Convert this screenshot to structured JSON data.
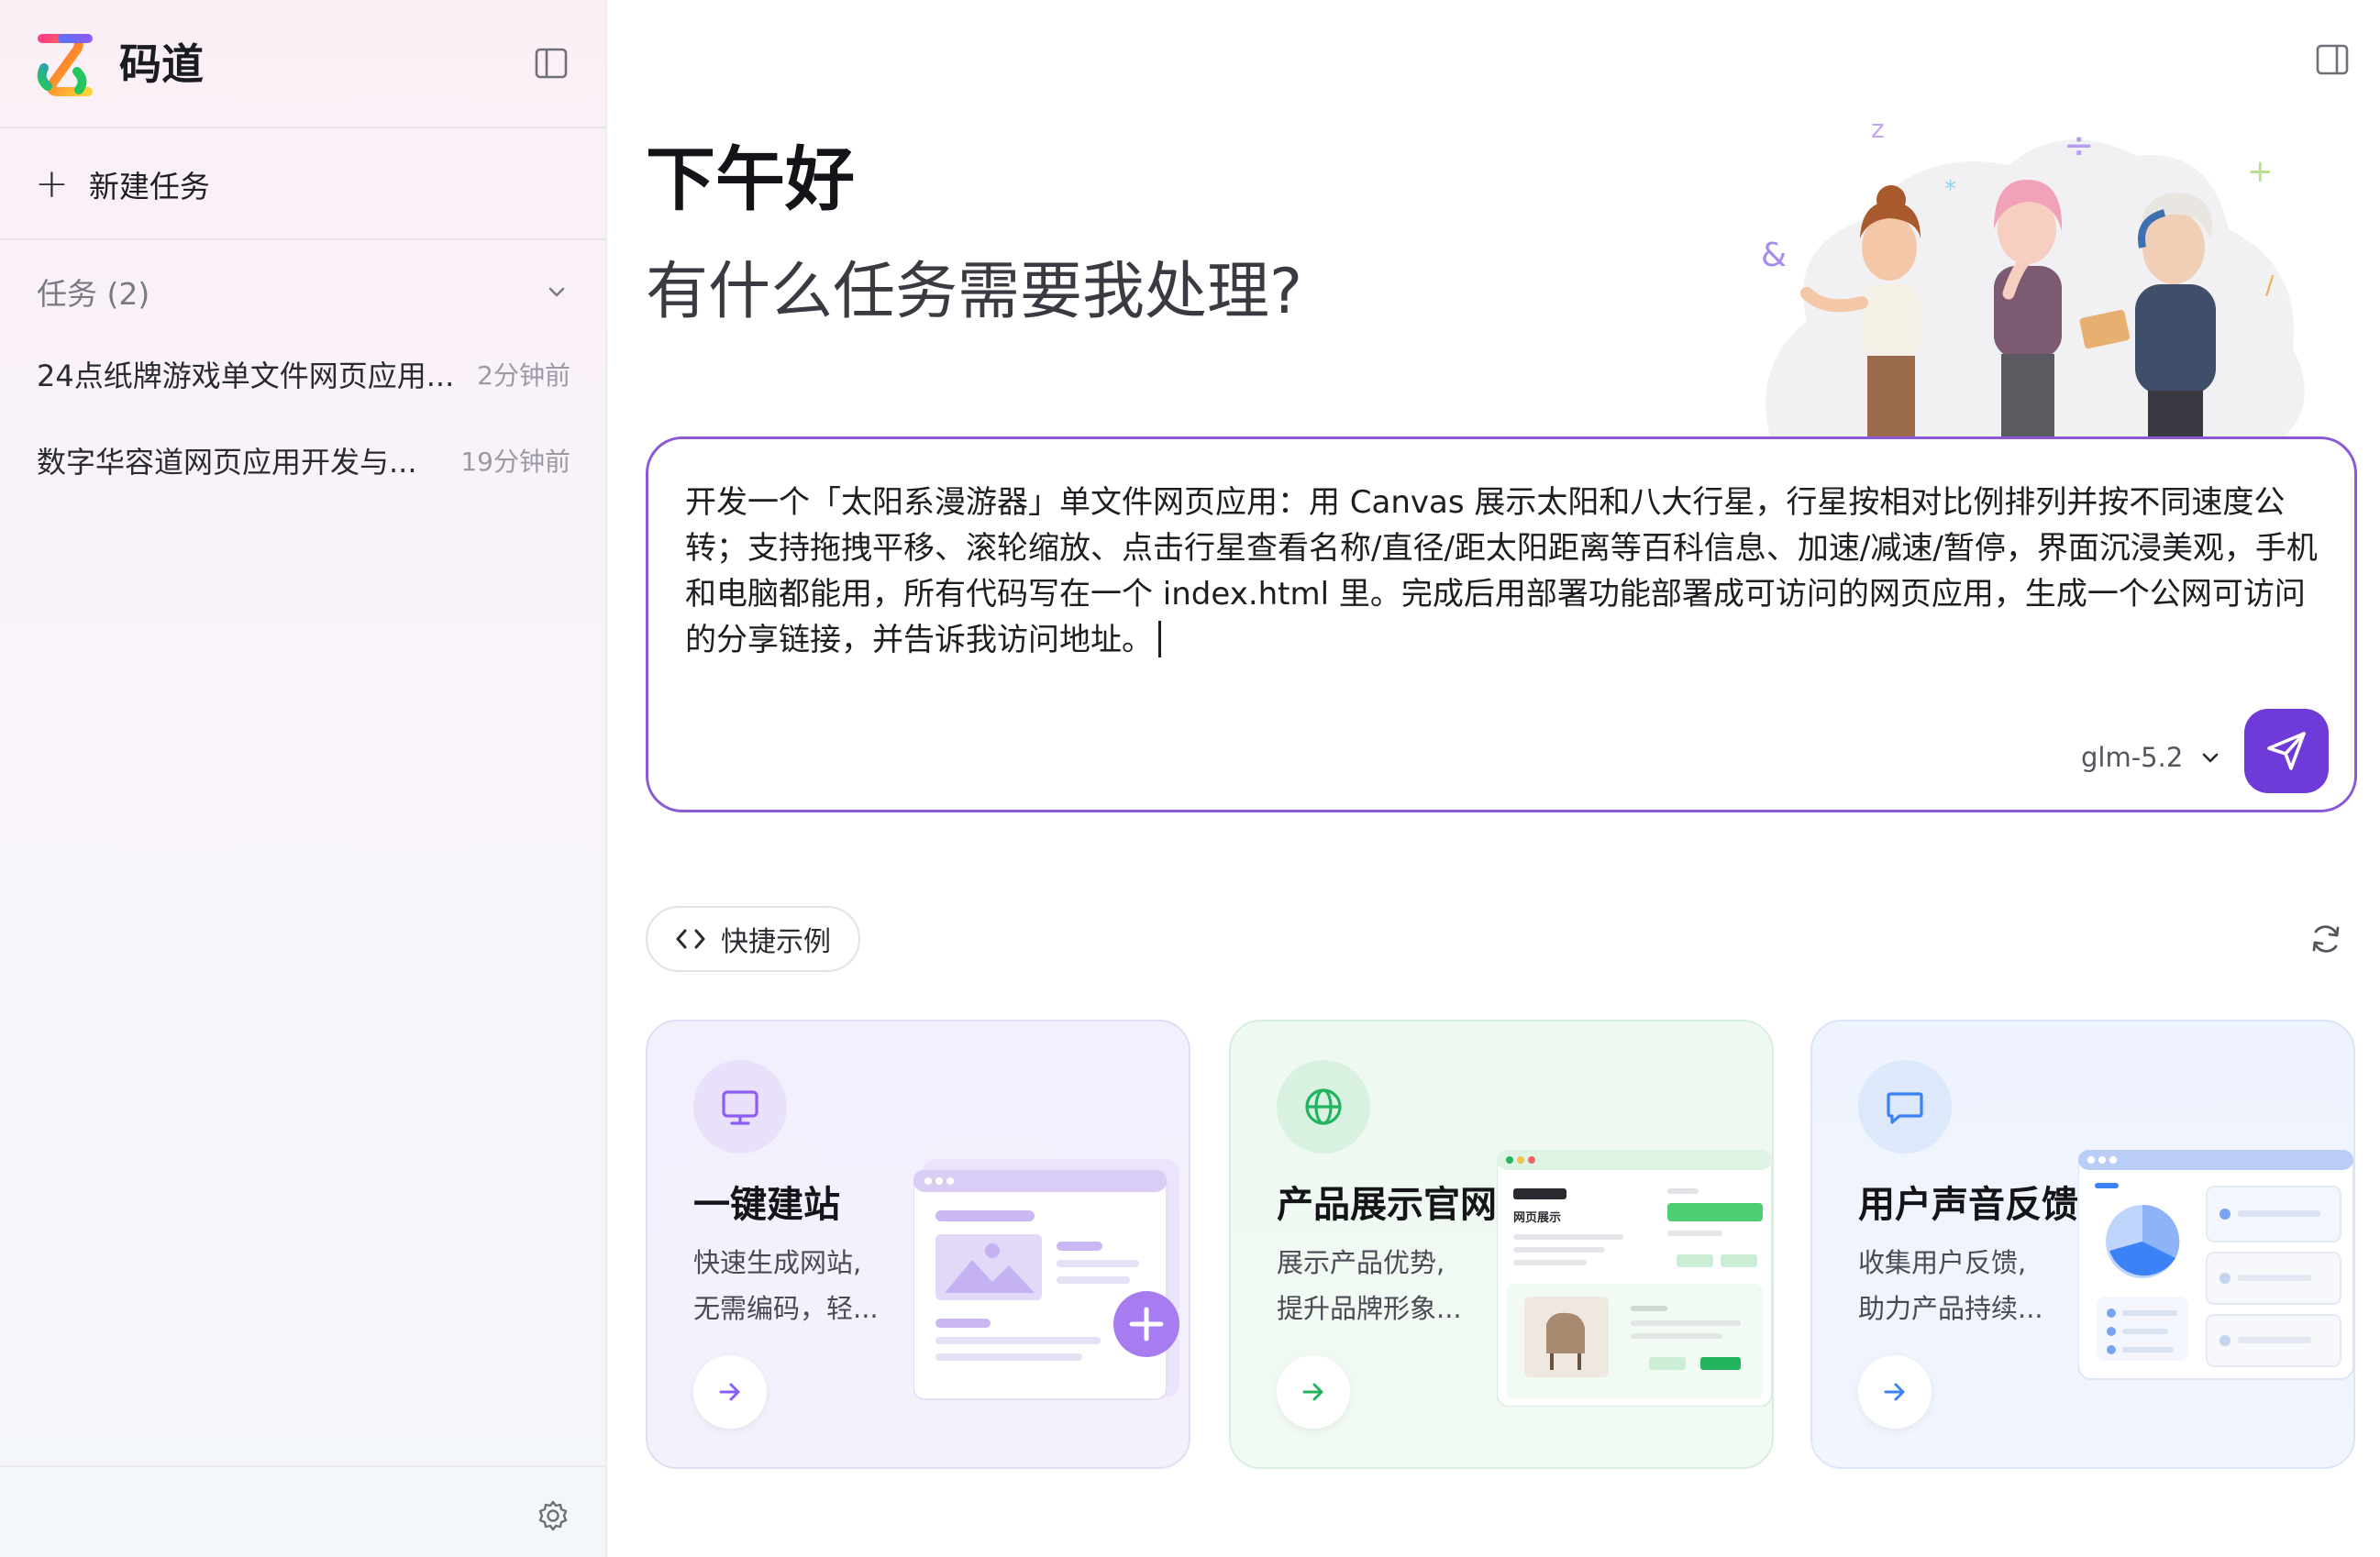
{
  "brand": {
    "name": "码道"
  },
  "sidebar": {
    "new_task_label": "新建任务",
    "tasks_header": "任务 (2)",
    "tasks": [
      {
        "title": "24点纸牌游戏单文件网页应用...",
        "time": "2分钟前"
      },
      {
        "title": "数字华容道网页应用开发与...",
        "time": "19分钟前"
      }
    ]
  },
  "main": {
    "greeting": "下午好",
    "subtitle": "有什么任务需要我处理?",
    "composer": {
      "text": "开发一个「太阳系漫游器」单文件网页应用：用 Canvas 展示太阳和八大行星，行星按相对比例排列并按不同速度公转；支持拖拽平移、滚轮缩放、点击行星查看名称/直径/距太阳距离等百科信息、加速/减速/暂停，界面沉浸美观，手机和电脑都能用，所有代码写在一个 index.html 里。完成后用部署功能部署成可访问的网页应用，生成一个公网可访问的分享链接，并告诉我访问地址。",
      "model": "glm-5.2"
    },
    "quick_examples_label": "快捷示例",
    "cards": [
      {
        "title": "一键建站",
        "desc_line1": "快速生成网站,",
        "desc_line2": "无需编码，轻...",
        "icon": "monitor-icon",
        "accent": "#8b5cf6"
      },
      {
        "title": "产品展示官网",
        "desc_line1": "展示产品优势,",
        "desc_line2": "提升品牌形象...",
        "icon": "globe-icon",
        "accent": "#22b35e",
        "preview_label": "网页展示"
      },
      {
        "title": "用户声音反馈",
        "desc_line1": "收集用户反馈,",
        "desc_line2": "助力产品持续...",
        "icon": "message-square-icon",
        "accent": "#3b82f6"
      }
    ]
  },
  "colors": {
    "accent_purple": "#6f3bd8",
    "composer_border": "#8a5ad6",
    "green": "#22b35e",
    "blue": "#3b82f6"
  }
}
